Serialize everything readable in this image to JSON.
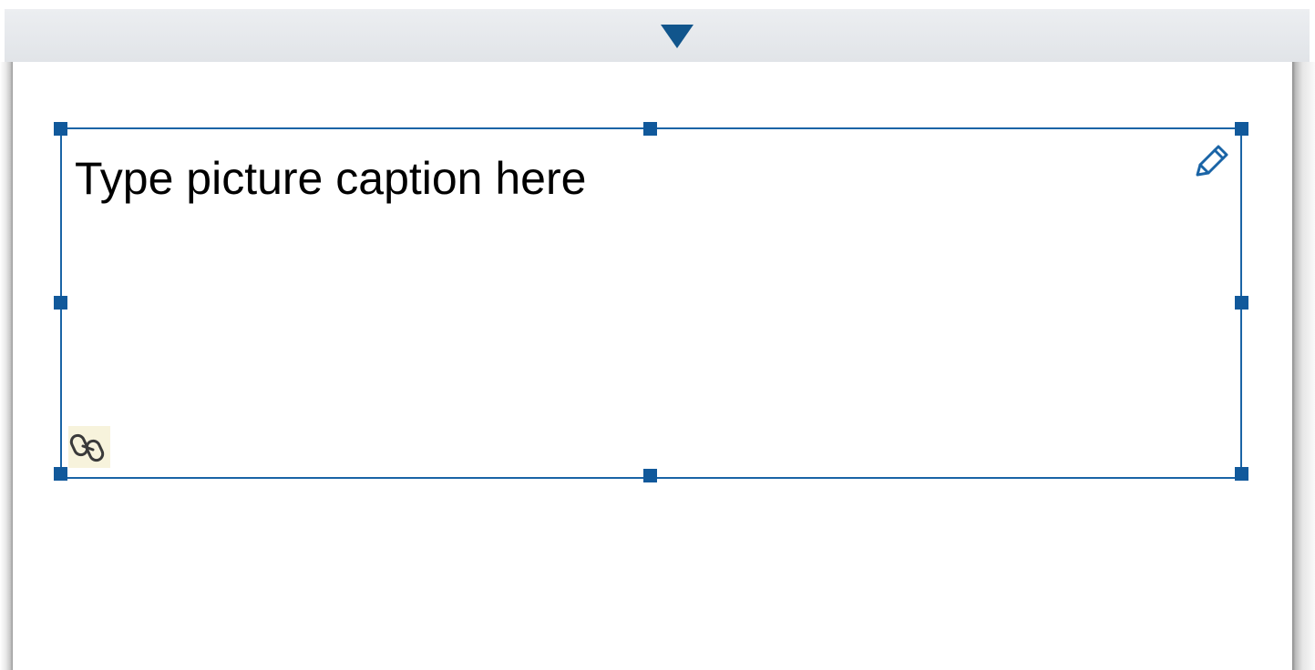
{
  "caption": {
    "placeholder_text": "Type picture caption here"
  },
  "icons": {
    "page_nav": "triangle-down-icon",
    "edit": "pencil-icon",
    "link": "link-icon"
  },
  "colors": {
    "accent": "#11599b",
    "frame_border": "#1a64a6",
    "top_bar": "#e4e7eb",
    "page_background": "#ffffff"
  }
}
